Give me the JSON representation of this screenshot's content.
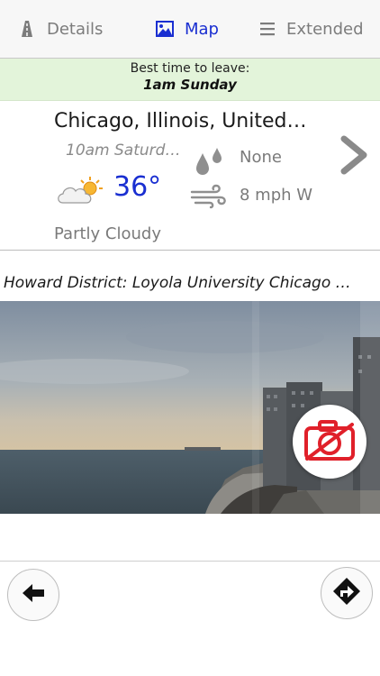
{
  "tabs": {
    "details": {
      "label": "Details",
      "icon": "road-icon"
    },
    "map": {
      "label": "Map",
      "icon": "image-icon",
      "selected": true
    },
    "extended": {
      "label": "Extended",
      "icon": "menu-icon"
    }
  },
  "banner": {
    "line1": "Best time to leave:",
    "line2": "1am Sunday"
  },
  "weather": {
    "location": "Chicago, Illinois, United…",
    "time": "10am Saturd…",
    "temperature": "36°",
    "precipitation": "None",
    "wind": "8 mph W",
    "condition": "Partly Cloudy",
    "condition_icon": "partly-cloudy-icon"
  },
  "camera": {
    "caption": "Howard District: Loyola University Chicago …"
  },
  "colors": {
    "accent": "#1a2fd1",
    "banner_bg": "#e3f4da",
    "muted_text": "#7a7a7a",
    "no_camera_red": "#e0202a"
  }
}
